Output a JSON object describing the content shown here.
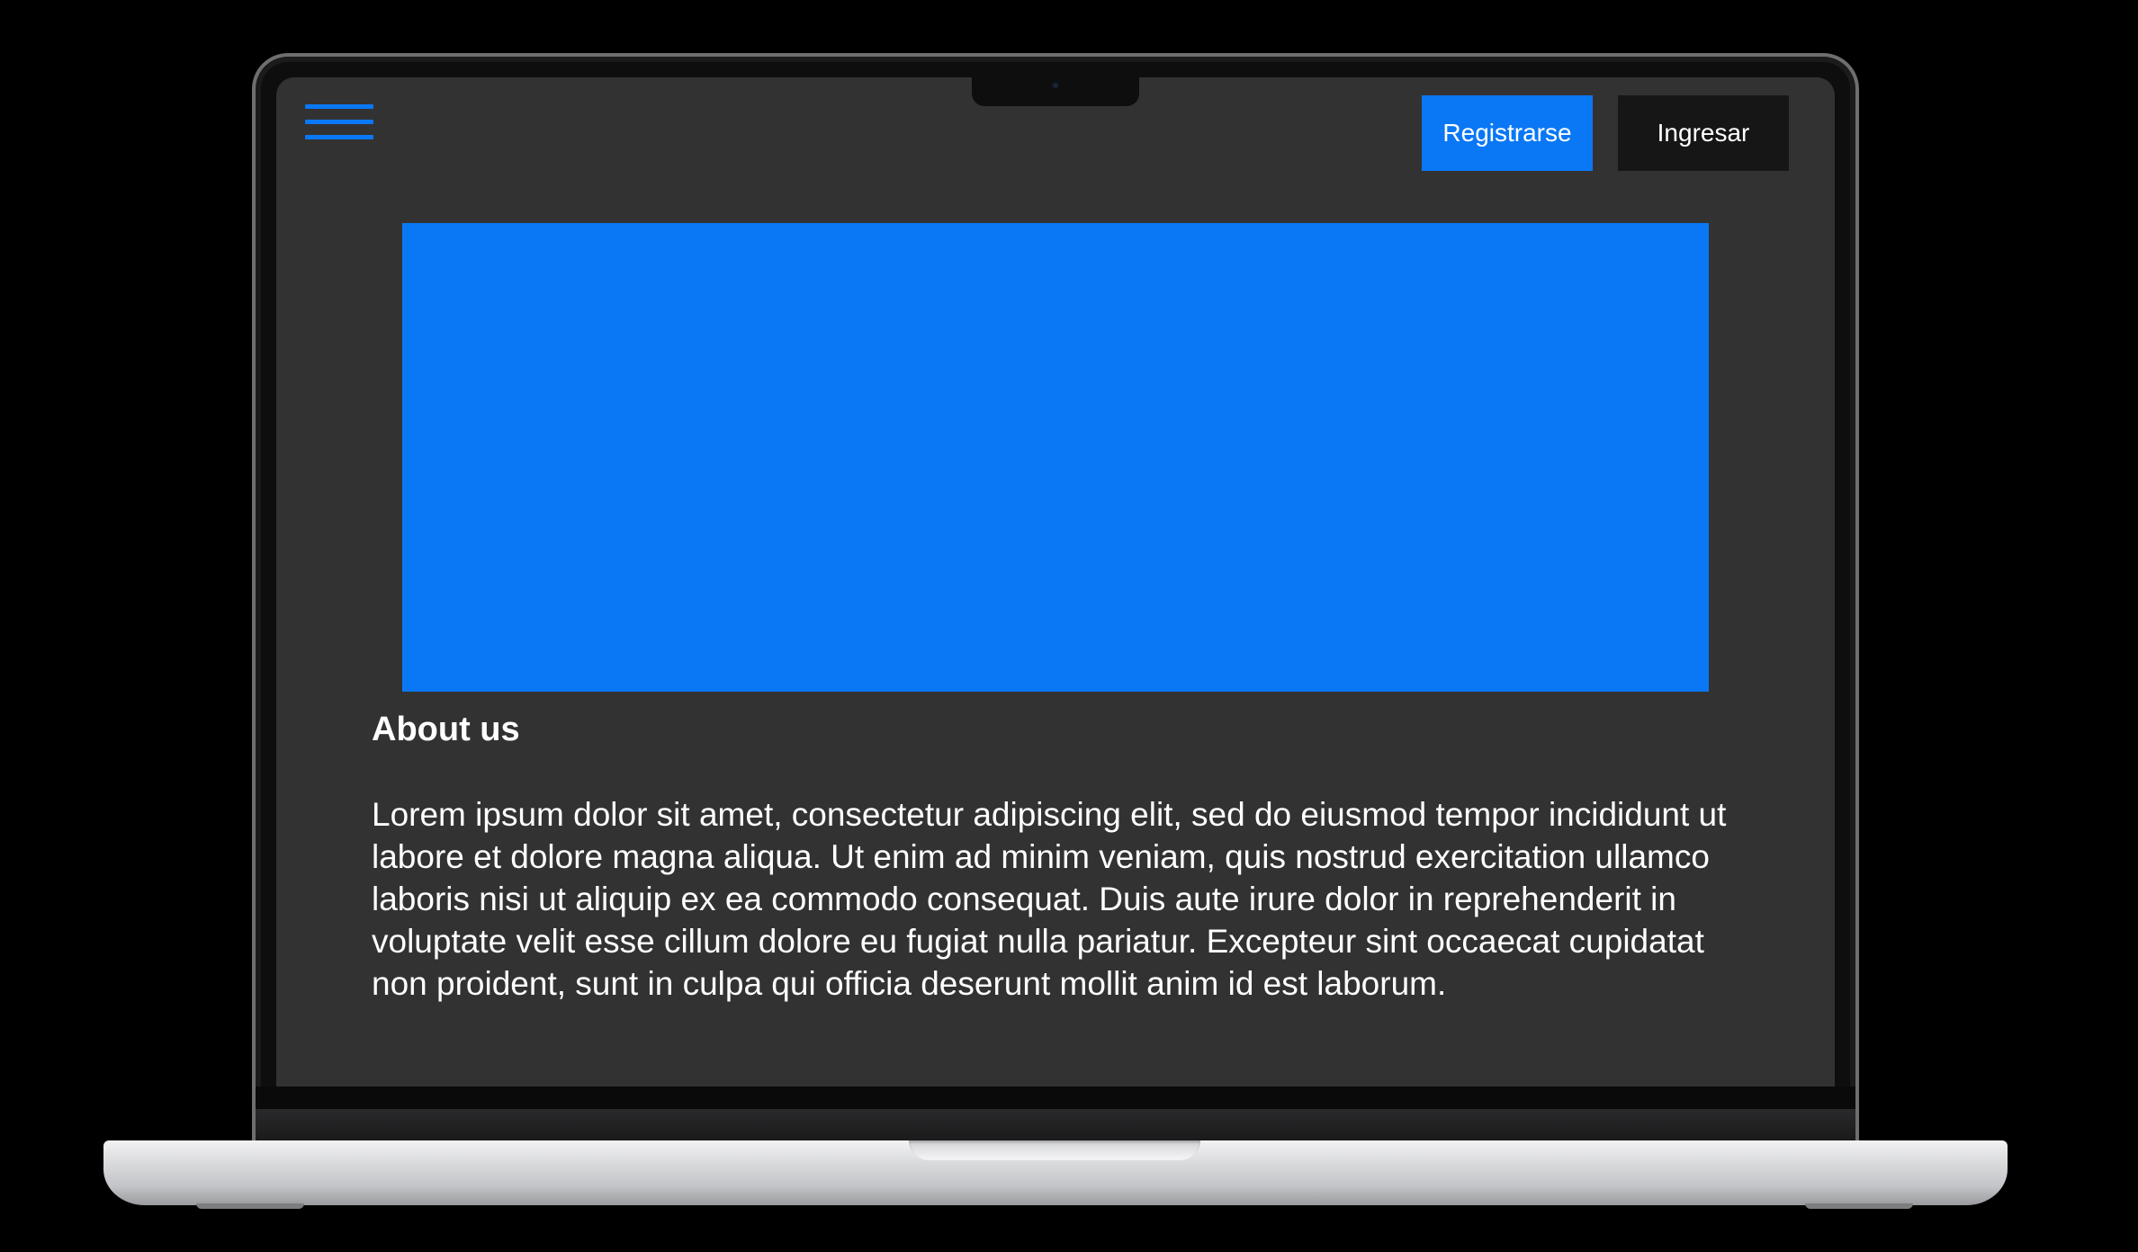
{
  "header": {
    "menu_icon": "hamburger-menu-icon",
    "register_label": "Registrarse",
    "login_label": "Ingresar"
  },
  "hero": {
    "color": "#0a78f5"
  },
  "about": {
    "title": "About us",
    "body": "Lorem ipsum dolor sit amet, consectetur adipiscing elit, sed do eiusmod tempor incididunt ut labore et dolore magna aliqua. Ut enim ad minim veniam, quis nostrud exercitation ullamco laboris nisi ut aliquip ex ea commodo consequat. Duis aute irure dolor in reprehenderit in voluptate velit esse cillum dolore eu fugiat nulla pariatur. Excepteur sint occaecat cupidatat non proident, sunt in culpa qui officia deserunt mollit anim id est laborum."
  },
  "colors": {
    "accent": "#0a78f5",
    "page_background": "#333233",
    "dark_button": "#161617",
    "text": "#ffffff"
  }
}
